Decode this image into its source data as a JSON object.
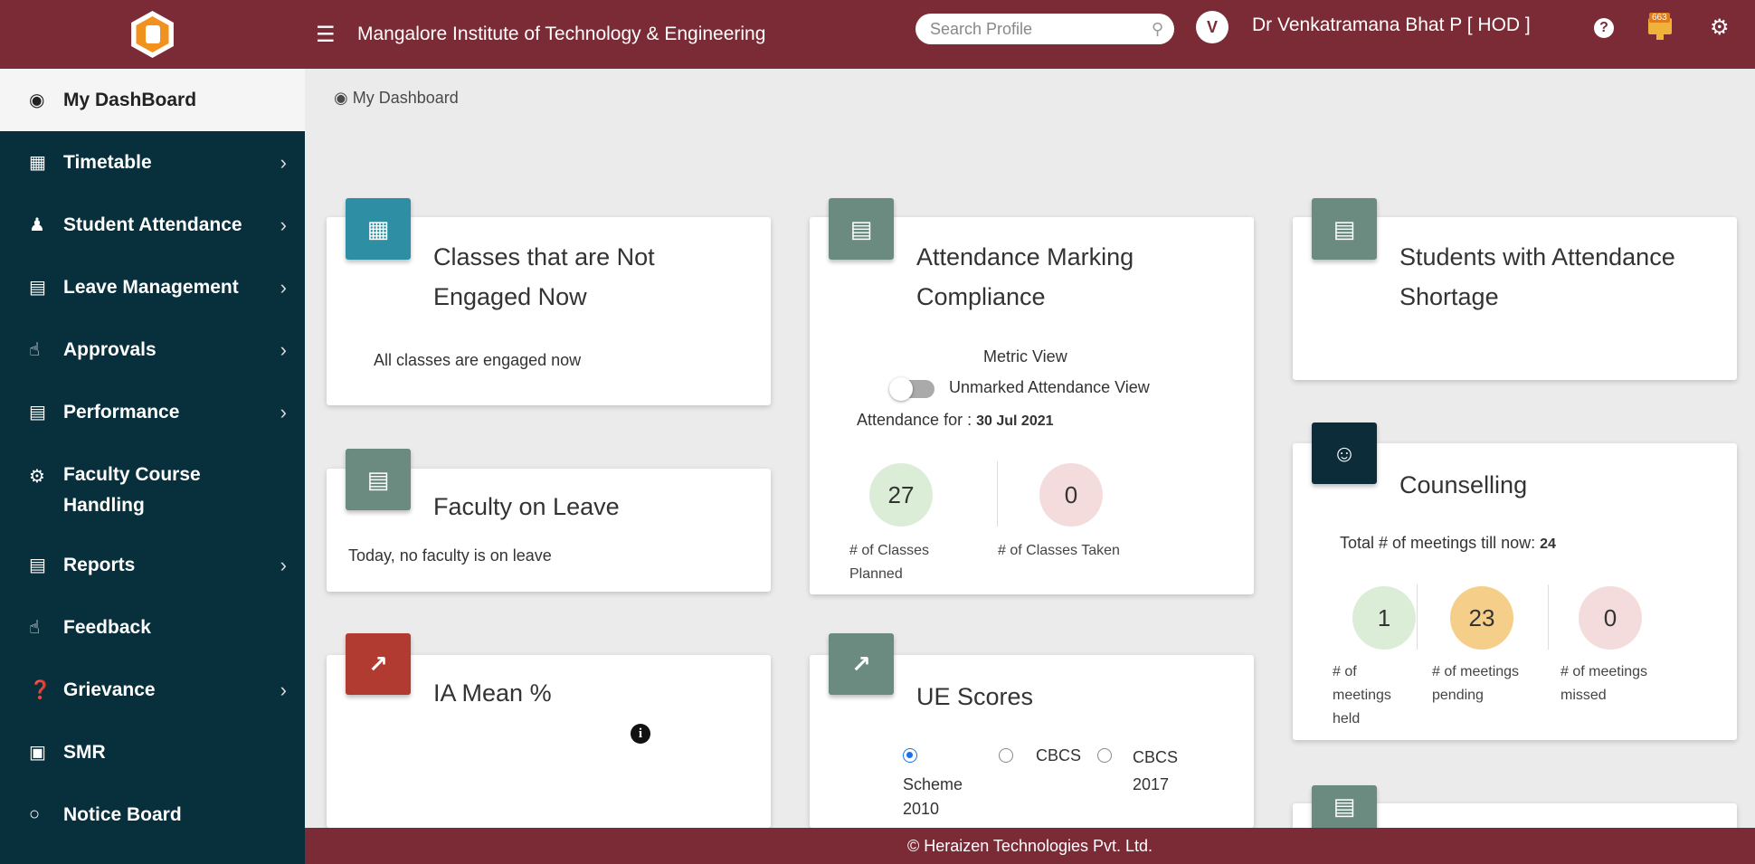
{
  "header": {
    "institute": "Mangalore Institute of Technology & Engineering",
    "search_placeholder": "Search Profile",
    "avatar_letter": "V",
    "user": "Dr Venkatramana Bhat P [ HOD ]",
    "notification_count": "663",
    "brand_color": "#7a2b36"
  },
  "sidebar": {
    "items": [
      {
        "label": "My DashBoard",
        "icon": "dashboard-icon"
      },
      {
        "label": "Timetable",
        "icon": "calendar-icon"
      },
      {
        "label": "Student Attendance",
        "icon": "user-icon"
      },
      {
        "label": "Leave Management",
        "icon": "bar-chart-icon"
      },
      {
        "label": "Approvals",
        "icon": "thumbs-up-icon"
      },
      {
        "label": "Performance",
        "icon": "bar-chart-icon"
      },
      {
        "label": "Faculty Course",
        "label2": "Handling",
        "icon": "gear-icon"
      },
      {
        "label": "Reports",
        "icon": "file-icon"
      },
      {
        "label": "Feedback",
        "icon": "thumbs-up-icon"
      },
      {
        "label": "Grievance",
        "icon": "question-icon"
      },
      {
        "label": "SMR",
        "icon": "id-card-icon"
      },
      {
        "label": "Notice Board",
        "icon": "circle-icon"
      }
    ]
  },
  "breadcrumb": "My Dashboard",
  "cards": {
    "not_engaged": {
      "title1": "Classes that are Not",
      "title2": "Engaged Now",
      "text": "All classes are engaged now"
    },
    "faculty_leave": {
      "title": "Faculty on Leave",
      "text": "Today, no faculty is on leave"
    },
    "ia_mean": {
      "title": "IA Mean %"
    },
    "compliance": {
      "title1": "Attendance Marking",
      "title2": "Compliance",
      "metric_view": "Metric View",
      "unmarked_view": "Unmarked Attendance View",
      "attendance_for": "Attendance for :",
      "date": "30 Jul 2021",
      "planned": "27",
      "planned_label1": "# of Classes",
      "planned_label2": "Planned",
      "taken": "0",
      "taken_label": "# of Classes Taken"
    },
    "ue_scores": {
      "title": "UE Scores",
      "opt1_a": "Scheme",
      "opt1_b": "2010",
      "opt2": "CBCS",
      "opt3_a": "CBCS",
      "opt3_b": "2017"
    },
    "shortage": {
      "title1": "Students with Attendance",
      "title2": "Shortage"
    },
    "counselling": {
      "title": "Counselling",
      "total_label": "Total # of meetings till now:",
      "total": "24",
      "held": "1",
      "held_l1": "# of",
      "held_l2": "meetings",
      "held_l3": "held",
      "pending": "23",
      "pending_l1": "# of meetings",
      "pending_l2": "pending",
      "missed": "0",
      "missed_l1": "# of meetings",
      "missed_l2": "missed"
    }
  },
  "footer": "© Heraizen Technologies Pvt. Ltd."
}
